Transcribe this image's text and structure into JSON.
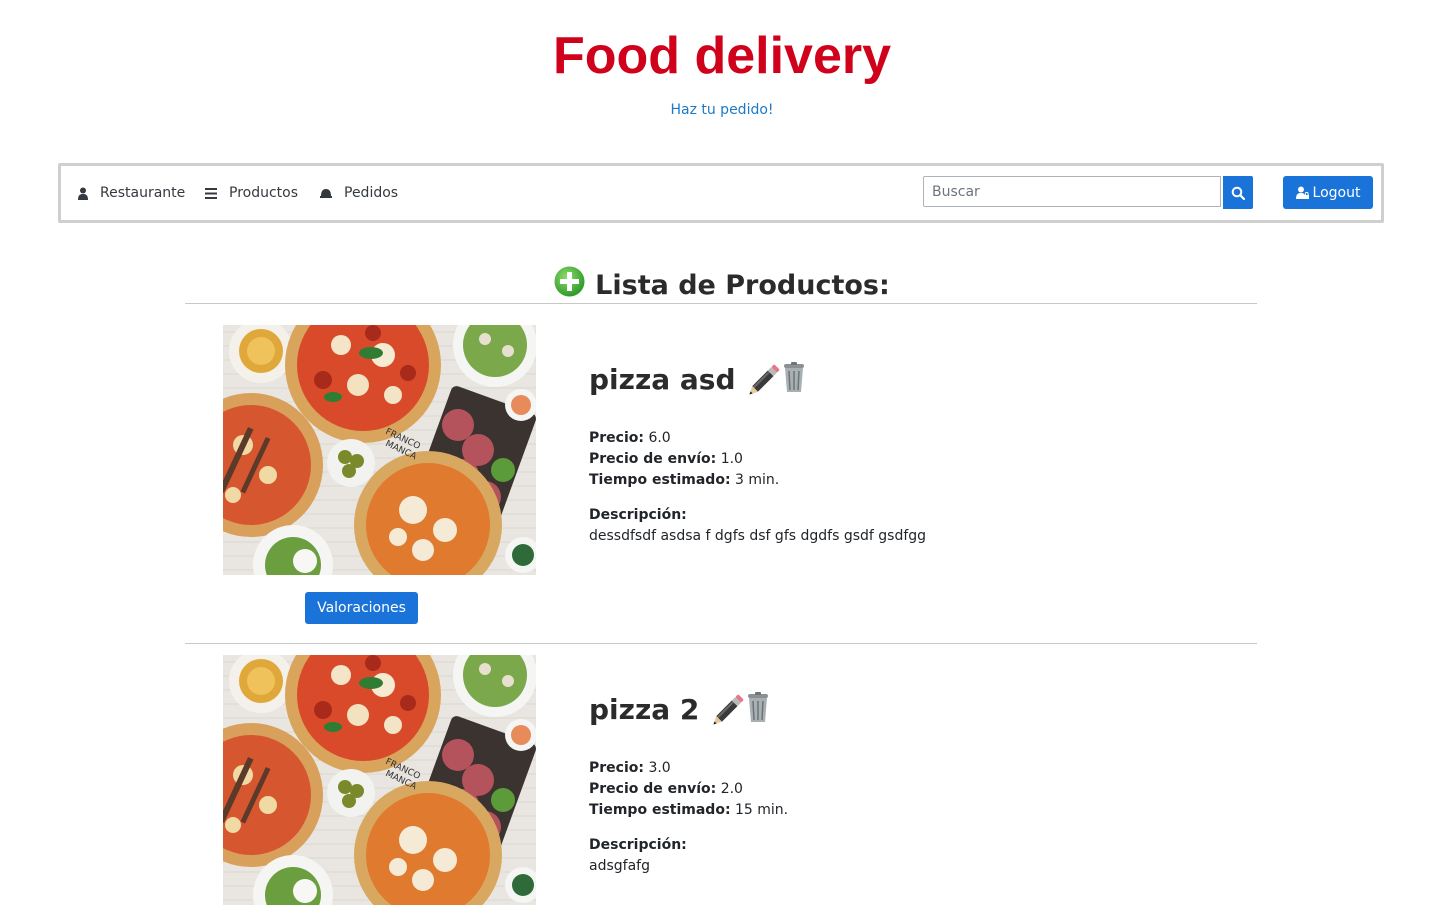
{
  "header": {
    "title": "Food delivery",
    "subtitle": "Haz tu pedido!"
  },
  "nav": {
    "items": [
      {
        "label": "Restaurante",
        "icon": "user-icon"
      },
      {
        "label": "Productos",
        "icon": "list-icon"
      },
      {
        "label": "Pedidos",
        "icon": "dish-icon"
      }
    ],
    "search_placeholder": "Buscar",
    "logout_label": "Logout"
  },
  "main": {
    "heading": "Lista de Productos:",
    "labels": {
      "precio": "Precio:",
      "envio": "Precio de envío:",
      "tiempo": "Tiempo estimado:",
      "descripcion": "Descripción:",
      "valoraciones": "Valoraciones"
    },
    "products": [
      {
        "name": "pizza asd",
        "precio": "6.0",
        "envio": "1.0",
        "tiempo": "3 min.",
        "descripcion": "dessdfsdf asdsa f dgfs dsf gfs dgdfs gsdf gsdfgg"
      },
      {
        "name": "pizza 2",
        "precio": "3.0",
        "envio": "2.0",
        "tiempo": "15 min.",
        "descripcion": "adsgfafg"
      }
    ]
  },
  "colors": {
    "title": "#d0021b",
    "link": "#1a7ac7",
    "primary": "#1a73d9",
    "add": "#4caf50"
  }
}
